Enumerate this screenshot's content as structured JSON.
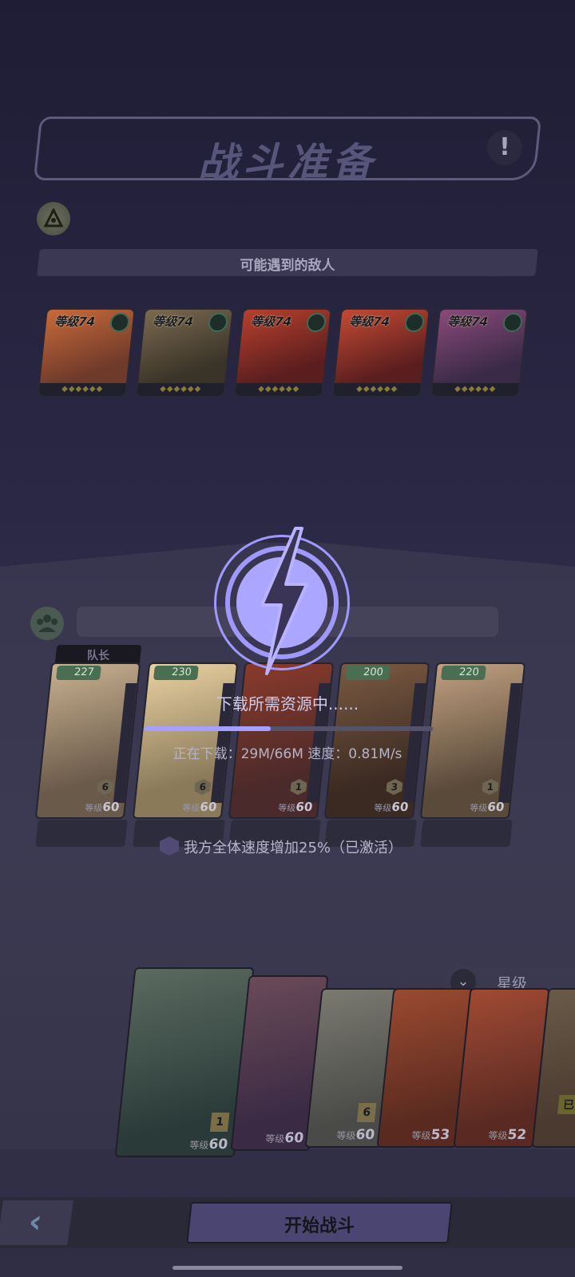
{
  "header": {
    "title": "战斗准备",
    "info_icon": "exclamation-icon"
  },
  "enemies": {
    "section_label": "可能遇到的敌人",
    "cards": [
      {
        "level": "等级74",
        "element": "green-swirl",
        "colors": [
          "#6e3a2a",
          "#c86a3a"
        ]
      },
      {
        "level": "等级74",
        "element": "grey-cross",
        "colors": [
          "#3a3328",
          "#7a6a50"
        ]
      },
      {
        "level": "等级74",
        "element": "green-swirl",
        "colors": [
          "#5a1e1e",
          "#b8402e"
        ]
      },
      {
        "level": "等级74",
        "element": "green-swirl",
        "colors": [
          "#5a1e1e",
          "#c44a34"
        ]
      },
      {
        "level": "等级74",
        "element": "purple-orb",
        "colors": [
          "#3a2a48",
          "#8a4a7a"
        ]
      }
    ]
  },
  "party": {
    "captain_label": "队长",
    "heroes": [
      {
        "power": "227",
        "tier": "6",
        "level": "60",
        "level_prefix": "等级",
        "colors": [
          "#6a5a4a",
          "#c8b090"
        ]
      },
      {
        "power": "230",
        "tier": "6",
        "level": "60",
        "level_prefix": "等级",
        "colors": [
          "#8a7a5a",
          "#e8d0a0"
        ]
      },
      {
        "power": "",
        "tier": "1",
        "level": "60",
        "level_prefix": "等级",
        "colors": [
          "#4a2a2a",
          "#8a3a2a"
        ]
      },
      {
        "power": "200",
        "tier": "3",
        "level": "60",
        "level_prefix": "等级",
        "colors": [
          "#3a2a22",
          "#7a5a42"
        ]
      },
      {
        "power": "220",
        "tier": "1",
        "level": "60",
        "level_prefix": "等级",
        "colors": [
          "#5a4a3a",
          "#c0a080"
        ]
      }
    ],
    "buff_text": "我方全体速度增加25%（已激活）"
  },
  "download": {
    "status": "下载所需资源中......",
    "progress_text": "正在下载：29M/66M  速度：0.81M/s",
    "progress": 0.44,
    "accent": "#a59fff"
  },
  "roster": {
    "sort_label": "星级",
    "cards": [
      {
        "level": "60",
        "level_prefix": "等级",
        "tier": "1",
        "colors": [
          "#2a3a38",
          "#5a6a60"
        ]
      },
      {
        "level": "60",
        "level_prefix": "等级",
        "colors": [
          "#3a2a44",
          "#6a4a58"
        ]
      },
      {
        "level": "60",
        "level_prefix": "等级",
        "tier": "6",
        "colors": [
          "#4a4a48",
          "#7a7a70"
        ]
      },
      {
        "level": "53",
        "level_prefix": "等级",
        "colors": [
          "#5a2a20",
          "#9a4a30"
        ]
      },
      {
        "level": "52",
        "level_prefix": "等级",
        "colors": [
          "#5a2a22",
          "#a04a34"
        ]
      },
      {
        "level": "",
        "level_prefix": "",
        "badge": "已",
        "colors": [
          "#4a3a30",
          "#6a5a48"
        ]
      }
    ]
  },
  "footer": {
    "back_icon": "chevron-left-icon",
    "start_label": "开始战斗"
  }
}
